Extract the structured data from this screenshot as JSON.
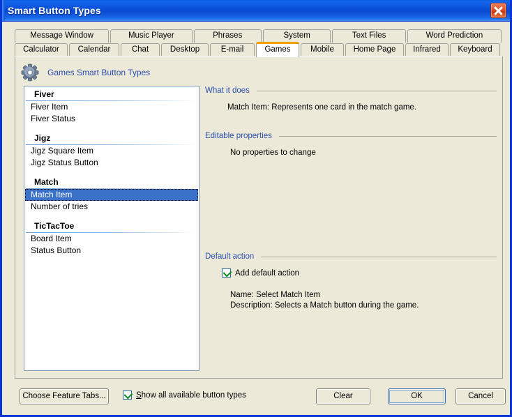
{
  "window": {
    "title": "Smart Button Types",
    "close_icon": "close-icon"
  },
  "tabs": {
    "row1": [
      {
        "label": "Message Window",
        "selected": false
      },
      {
        "label": "Music Player",
        "selected": false
      },
      {
        "label": "Phrases",
        "selected": false
      },
      {
        "label": "System",
        "selected": false
      },
      {
        "label": "Text Files",
        "selected": false
      },
      {
        "label": "Word Prediction",
        "selected": false
      }
    ],
    "row2": [
      {
        "label": "Calculator",
        "selected": false
      },
      {
        "label": "Calendar",
        "selected": false
      },
      {
        "label": "Chat",
        "selected": false
      },
      {
        "label": "Desktop",
        "selected": false
      },
      {
        "label": "E-mail",
        "selected": false
      },
      {
        "label": "Games",
        "selected": true
      },
      {
        "label": "Mobile",
        "selected": false
      },
      {
        "label": "Home Page",
        "selected": false
      },
      {
        "label": "Infrared",
        "selected": false
      },
      {
        "label": "Keyboard",
        "selected": false
      }
    ]
  },
  "panel": {
    "icon": "gear-icon",
    "header_label": "Games Smart Button Types"
  },
  "listbox": {
    "groups": [
      {
        "title": "Fiver",
        "items": [
          {
            "label": "Fiver Item",
            "selected": false
          },
          {
            "label": "Fiver Status",
            "selected": false
          }
        ]
      },
      {
        "title": "Jigz",
        "items": [
          {
            "label": "Jigz Square Item",
            "selected": false
          },
          {
            "label": "Jigz Status Button",
            "selected": false
          }
        ]
      },
      {
        "title": "Match",
        "items": [
          {
            "label": "Match Item",
            "selected": true
          },
          {
            "label": "Number of tries",
            "selected": false
          }
        ]
      },
      {
        "title": "TicTacToe",
        "items": [
          {
            "label": "Board Item",
            "selected": false
          },
          {
            "label": "Status Button",
            "selected": false
          }
        ]
      }
    ]
  },
  "detail": {
    "what_it_does": {
      "label": "What it does",
      "text": "Match Item: Represents one card in the match game."
    },
    "editable_properties": {
      "label": "Editable properties",
      "text": "No properties to change"
    },
    "default_action": {
      "label": "Default action",
      "checkbox_label": "Add default action",
      "checked": true,
      "name_line": "Name: Select Match Item",
      "description_line": "Description: Selects a Match button during the game."
    }
  },
  "bottom": {
    "choose_feature_tabs": "Choose Feature Tabs...",
    "show_all_prefix": "S",
    "show_all_rest": "how all available button types",
    "show_all_checked": true,
    "clear": "Clear",
    "ok": "OK",
    "cancel": "Cancel"
  },
  "colors": {
    "titlebar_blue": "#0b51d8",
    "dialog_face": "#ece9d8",
    "selection_blue": "#3b72c9",
    "link_blue": "#2a4fb0",
    "tab_accent_orange": "#f0a000",
    "check_green": "#0a8a22"
  }
}
